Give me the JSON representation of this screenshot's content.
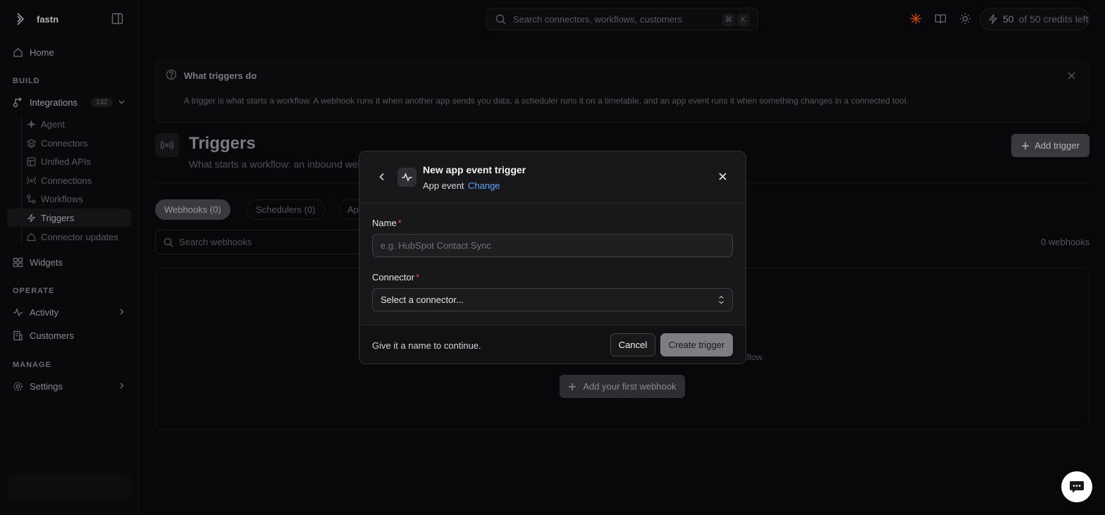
{
  "app": {
    "name": "fastn"
  },
  "sidebar": {
    "home": "Home",
    "build_label": "BUILD",
    "integrations": {
      "label": "Integrations",
      "count": "132"
    },
    "sub_items": [
      "Agent",
      "Connectors",
      "Unified APIs",
      "Connections",
      "Workflows",
      "Triggers",
      "Connector updates"
    ],
    "widgets": "Widgets",
    "operate_label": "OPERATE",
    "activity": "Activity",
    "customers": "Customers",
    "manage_label": "MANAGE",
    "settings": "Settings",
    "active_item": "Triggers"
  },
  "topbar": {
    "search_placeholder": "Search connectors, workflows, customers",
    "shortcut": [
      "⌘",
      "K"
    ],
    "credits": {
      "used": "50",
      "text": "of 50 credits left"
    }
  },
  "info": {
    "title": "What triggers do",
    "text": "A trigger is what starts a workflow. A webhook runs it when another app sends you data, a scheduler runs it on a timetable, and an app event runs it when something changes in a connected tool."
  },
  "page": {
    "title": "Triggers",
    "subtitle": "What starts a workflow: an inbound webhook",
    "add_button": "Add trigger"
  },
  "tabs": [
    "Webhooks (0)",
    "Schedulers (0)",
    "Ap"
  ],
  "webhooks": {
    "search_placeholder": "Search webhooks",
    "count": "0 webhooks",
    "empty_tail": "rkflow.",
    "add_first": "Add your first webhook"
  },
  "modal": {
    "title": "New app event trigger",
    "type": "App event",
    "change": "Change",
    "name_label": "Name",
    "name_placeholder": "e.g. HubSpot Contact Sync",
    "connector_label": "Connector",
    "connector_value": "Select a connector...",
    "required_mark": "*",
    "hint": "Give it a name to continue.",
    "cancel": "Cancel",
    "create": "Create trigger"
  },
  "colors": {
    "background": "#08080a",
    "modal": "#18181b",
    "accent_link": "#60a5fa",
    "required": "#ef4444",
    "credit_icon": "#c2410c"
  }
}
